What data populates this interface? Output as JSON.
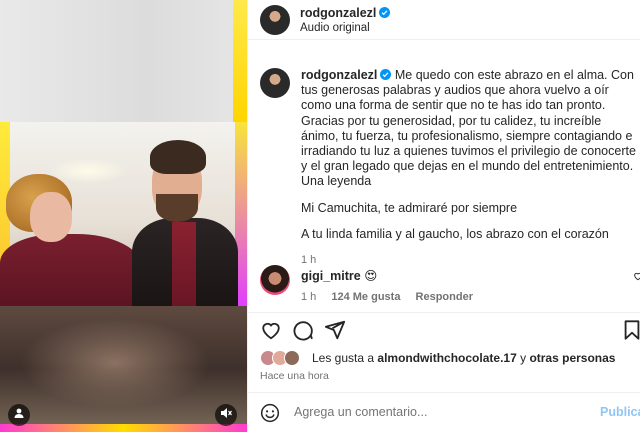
{
  "post": {
    "username": "rodgonzalezl",
    "audio": "Audio original"
  },
  "caption": {
    "username": "rodgonzalezl",
    "paragraphs": [
      "Me quedo con este abrazo en el alma. Con tus generosas palabras y audios que ahora vuelvo a oír como una forma de sentir que no te has ido tan pronto. Gracias por tu generosidad, por tu calidez, tu increíble ánimo, tu fuerza, tu profesionalismo, siempre contagiando e irradiando tu luz a quienes tuvimos el privilegio de conocerte y el gran legado que dejas en el mundo del entretenimiento. Una leyenda",
      "Mi Camuchita, te admiraré por siempre",
      "A tu linda familia y al gaucho, los abrazo con el corazón"
    ],
    "time": "1 h"
  },
  "comment": {
    "username": "gigi_mitre",
    "emoji": "😍",
    "time": "1 h",
    "likes": "124 Me gusta",
    "reply": "Responder"
  },
  "likes_line": {
    "prefix": "Les gusta a",
    "user": "almondwithchocolate.17",
    "connector": "y",
    "others": "otras personas"
  },
  "posted_ago": "Hace una hora",
  "comment_input": {
    "placeholder": "Agrega un comentario...",
    "post_label": "Publicar"
  },
  "colors": {
    "link_disabled": "#8fc6f5",
    "verified": "#0095f6",
    "muted": "#737373"
  }
}
